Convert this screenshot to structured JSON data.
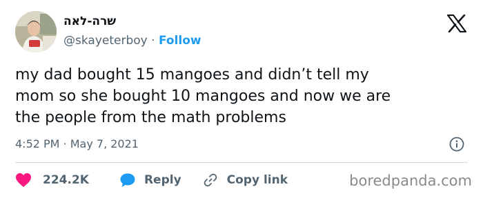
{
  "author": {
    "display_name": "שרה-לאה",
    "handle": "@skayeterboy",
    "separator": "·",
    "follow_label": "Follow"
  },
  "tweet": {
    "lines": [
      "my dad bought 15 mangoes and didn’t tell my",
      "mom so she bought 10 mangoes and now we are",
      "the people from the math problems"
    ],
    "timestamp": "4:52 PM · May 7, 2021"
  },
  "actions": {
    "like_count": "224.2K",
    "reply_label": "Reply",
    "copy_link_label": "Copy link"
  },
  "watermark": "boredpanda.com",
  "colors": {
    "accent": "#1d9bf0",
    "like": "#f91880",
    "text": "#0f1419",
    "secondary": "#536471",
    "divider": "#cfd9de"
  },
  "icons": {
    "brand": "x-logo-icon",
    "info": "info-icon",
    "like": "heart-icon",
    "reply": "speech-bubble-icon",
    "copy": "link-icon"
  }
}
